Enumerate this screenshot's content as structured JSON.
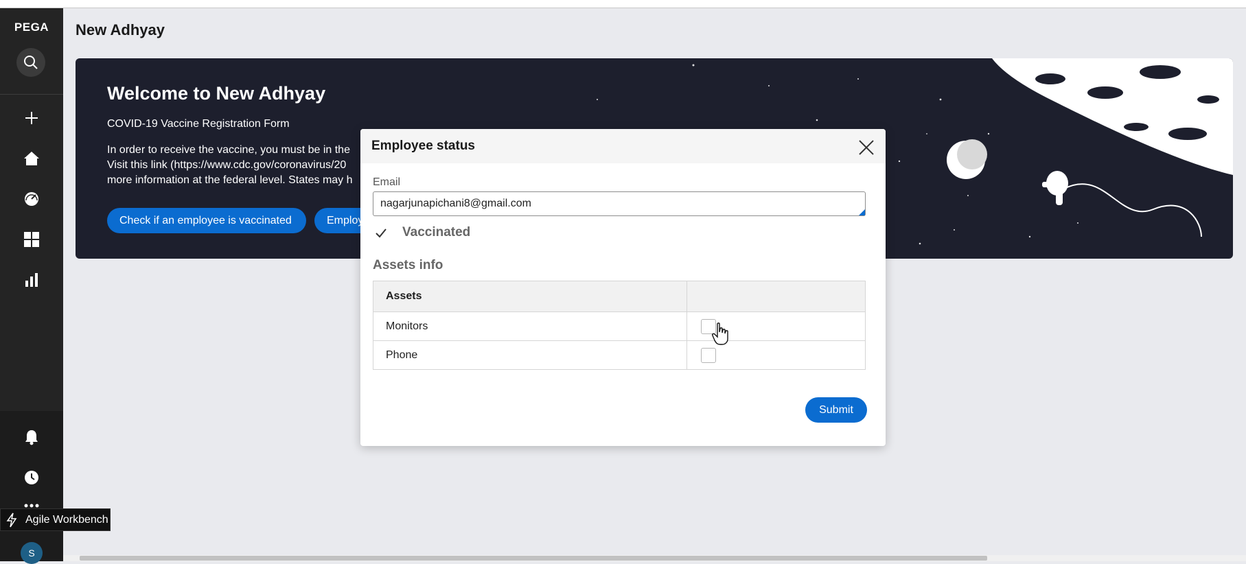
{
  "app": {
    "logo": "PEGA",
    "page_title": "New Adhyay"
  },
  "nav": {
    "items": [
      "search-icon",
      "add-icon",
      "home-icon",
      "dashboard-gauge-icon",
      "apps-grid-icon",
      "reports-icon"
    ],
    "bottom": [
      "bell-icon",
      "history-icon",
      "more-icon"
    ],
    "avatar_initial": "S",
    "workbench_label": "Agile Workbench"
  },
  "banner": {
    "heading": "Welcome to New Adhyay",
    "subtitle": "COVID-19 Vaccine Registration Form",
    "paragraph_lines": [
      "In order to receive the vaccine, you must be in the",
      "Visit this link (https://www.cdc.gov/coronavirus/20",
      "more information at the federal level. States may h"
    ],
    "buttons": [
      "Check if an employee is vaccinated",
      "Employ"
    ]
  },
  "modal": {
    "title": "Employee status",
    "email_label": "Email",
    "email_value": "nagarjunapichani8@gmail.com",
    "vaccinated_label": "Vaccinated",
    "assets_heading": "Assets info",
    "table": {
      "headers": [
        "Assets",
        ""
      ],
      "rows": [
        {
          "name": "Monitors",
          "checked": false
        },
        {
          "name": "Phone",
          "checked": false
        }
      ]
    },
    "submit_label": "Submit"
  },
  "colors": {
    "accent": "#0b6cd0",
    "nav_bg": "#242424",
    "banner_bg": "#1d1f2d",
    "page_bg": "#e9eaee"
  }
}
